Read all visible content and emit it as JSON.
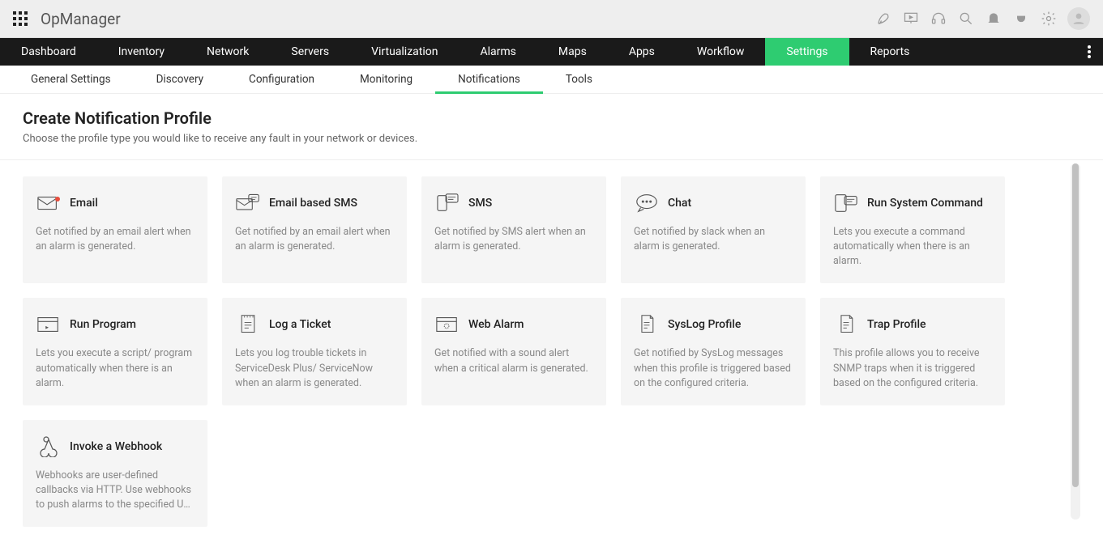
{
  "brand": "OpManager",
  "nav_main": [
    "Dashboard",
    "Inventory",
    "Network",
    "Servers",
    "Virtualization",
    "Alarms",
    "Maps",
    "Apps",
    "Workflow",
    "Settings",
    "Reports"
  ],
  "nav_main_active": 9,
  "nav_sub": [
    "General Settings",
    "Discovery",
    "Configuration",
    "Monitoring",
    "Notifications",
    "Tools"
  ],
  "nav_sub_active": 4,
  "page_title": "Create Notification Profile",
  "page_sub": "Choose the profile type you would like to receive any fault in your network or devices.",
  "cards": [
    {
      "title": "Email",
      "desc": "Get notified by an email alert when an alarm is generated.",
      "icon": "mail",
      "dot": true
    },
    {
      "title": "Email based SMS",
      "desc": "Get notified by an email alert when an alarm is generated.",
      "icon": "mailsms"
    },
    {
      "title": "SMS",
      "desc": "Get notified by SMS alert when an alarm is generated.",
      "icon": "sms"
    },
    {
      "title": "Chat",
      "desc": "Get notified by slack when an alarm is generated.",
      "icon": "chat"
    },
    {
      "title": "Run System Command",
      "desc": "Lets you execute a command automatically when there is an alarm.",
      "icon": "cmd"
    },
    {
      "title": "Run Program",
      "desc": "Lets you execute a script/ program automatically when there is an alarm.",
      "icon": "run"
    },
    {
      "title": "Log a Ticket",
      "desc": "Lets you log trouble tickets in ServiceDesk Plus/ ServiceNow when an alarm is generated.",
      "icon": "ticket"
    },
    {
      "title": "Web Alarm",
      "desc": "Get notified with a sound alert when a critical alarm is generated.",
      "icon": "web"
    },
    {
      "title": "SysLog Profile",
      "desc": "Get notified by SysLog messages when this profile is triggered based on the configured criteria.",
      "icon": "syslog"
    },
    {
      "title": "Trap Profile",
      "desc": "This profile allows you to receive SNMP traps when it is triggered based on the configured criteria.",
      "icon": "trap"
    },
    {
      "title": "Invoke a Webhook",
      "desc": "Webhooks are user-defined callbacks via HTTP. Use webhooks to push alarms to the specified U…",
      "icon": "webhook"
    }
  ]
}
